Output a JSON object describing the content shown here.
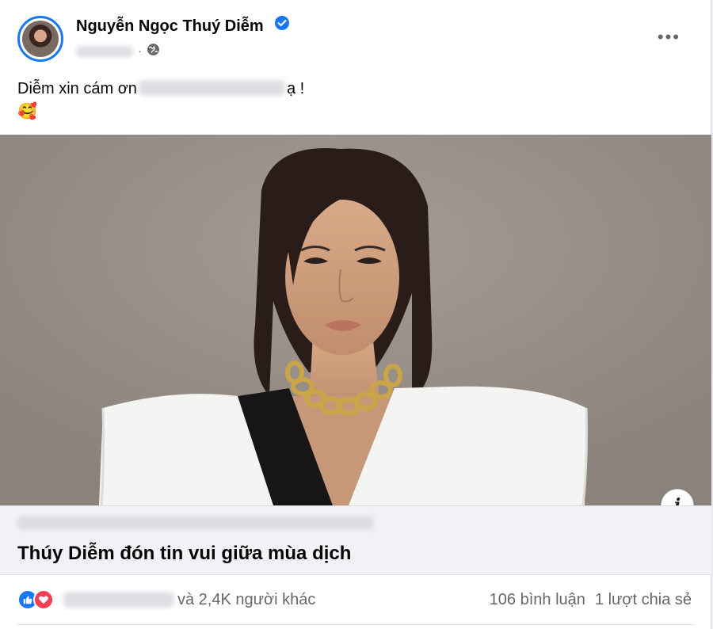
{
  "post": {
    "author": "Nguyễn Ngọc Thuý Diễm",
    "text_before": "Diễm xin cám ơn",
    "text_after": "ạ !",
    "emoji": "🥰"
  },
  "link_preview": {
    "title": "Thúy Diễm đón tin vui giữa mùa dịch"
  },
  "engagement": {
    "others_text": "và 2,4K người khác",
    "comments": "106 bình luận",
    "shares": "1 lượt chia sẻ"
  },
  "icons": {
    "verified": "verified-badge-icon",
    "privacy": "globe-icon",
    "more": "more-options-icon",
    "info": "info-icon",
    "like": "like-reaction-icon",
    "love": "love-reaction-icon"
  },
  "colors": {
    "accent": "#1877f2",
    "love": "#f33e58",
    "muted_text": "#65676b",
    "photo_background": "#9a9189"
  }
}
